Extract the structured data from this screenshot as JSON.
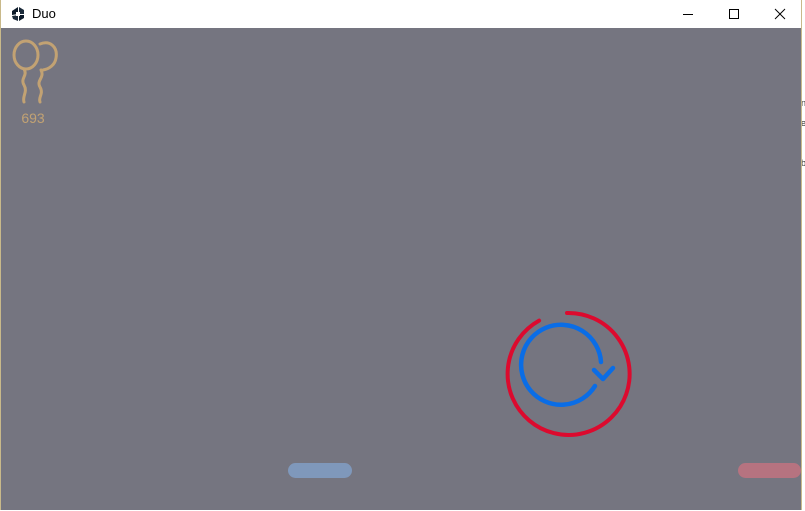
{
  "window": {
    "title": "Duo",
    "icon": "app-logo-icon",
    "controls": [
      "minimize-icon",
      "maximize-icon",
      "close-icon"
    ]
  },
  "game": {
    "background_color": "#757580",
    "score": {
      "icon": "balloons-icon",
      "value": "693",
      "color": "#c2a273"
    },
    "restart": {
      "icon": "restart-icon",
      "outer_ring_color": "#dc0a2e",
      "inner_arrow_color": "#0a6de6"
    },
    "paddles": [
      {
        "name": "blue-paddle",
        "color": "#7f98bb"
      },
      {
        "name": "red-paddle",
        "color": "#b67380"
      }
    ]
  }
}
